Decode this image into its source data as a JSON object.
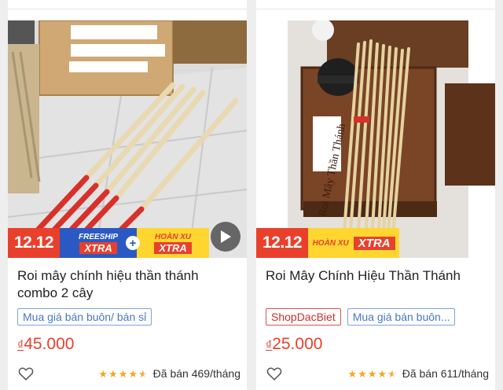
{
  "products": [
    {
      "title": "Roi mây chính hiệu thần thánh combo 2 cây",
      "promo": {
        "date": "12.12",
        "freeship": "FREESHIP",
        "freeship_xtra": "XTRA",
        "plus": "+",
        "hoanxu": "HOÀN XU",
        "hoanxu_xtra": "XTRA"
      },
      "has_video": true,
      "tags": [
        "Mua giá bán buôn/ bán sỉ"
      ],
      "price_currency": "₫",
      "price": "45.000",
      "rating": 4.5,
      "sold": "Đã bán 469/tháng"
    },
    {
      "title": "Roi Mây Chính Hiệu Thần Thánh",
      "photo_caption": "Roi Mây Thần Thánh",
      "promo": {
        "date": "12.12",
        "hoanxu": "HOÀN XU",
        "hoanxu_xtra": "XTRA"
      },
      "has_video": false,
      "shop_tag": "ShopDacBiet",
      "tags": [
        "Mua giá bán buôn..."
      ],
      "price_currency": "₫",
      "price": "25.000",
      "rating": 4.5,
      "sold": "Đã bán 611/tháng"
    }
  ],
  "colors": {
    "accent": "#e9402c",
    "tag_blue": "#4a78bf",
    "star": "#f5a623",
    "freeship_blue": "#2b59c3",
    "xu_yellow": "#ffd630"
  },
  "icons": {
    "favorite": "heart-outline-icon",
    "play": "play-icon",
    "star": "star-icon"
  }
}
